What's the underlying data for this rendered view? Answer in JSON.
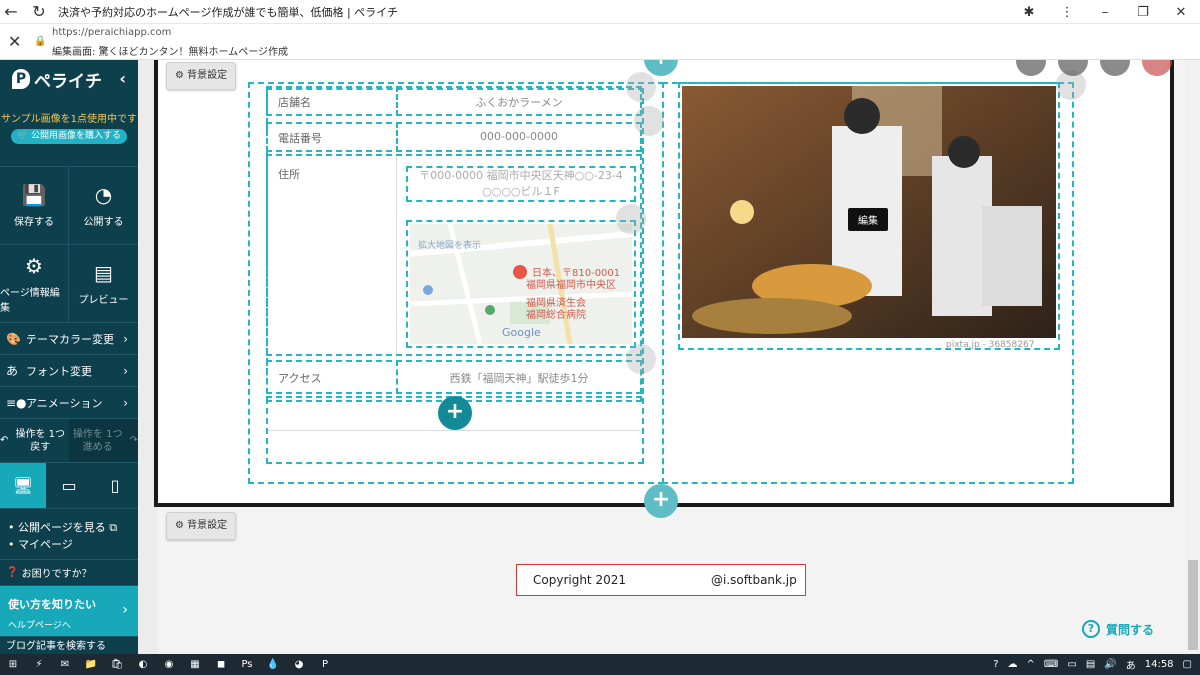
{
  "browser": {
    "tab_title": "決済や予約対応のホームページ作成が誰でも簡単、低価格 | ペライチ",
    "url": "https://peraichiapp.com",
    "site_description": "編集画面: 驚くほどカンタン！無料ホームページ作成"
  },
  "sidebar": {
    "logo": "ペライチ",
    "sample_notice": "サンプル画像を1点使用中です",
    "buy_button": "公開用画像を購入する",
    "actions": [
      {
        "label": "保存する",
        "icon": "save-icon"
      },
      {
        "label": "公開する",
        "icon": "publish-icon"
      },
      {
        "label": "ページ情報編集",
        "icon": "gear-icon"
      },
      {
        "label": "プレビュー",
        "icon": "preview-icon"
      }
    ],
    "menu": [
      {
        "label": "テーマカラー変更",
        "icon": "palette-icon"
      },
      {
        "label": "フォント変更",
        "icon": "font-icon"
      },
      {
        "label": "アニメーション",
        "icon": "animation-icon"
      }
    ],
    "undo": "操作を 1つ戻す",
    "redo": "操作を 1つ進める",
    "links": [
      "公開ページを見る",
      "マイページ"
    ],
    "help": "お困りですか？",
    "howto_title": "使い方を知りたい",
    "howto_sub": "ヘルプページへ",
    "bottom_text": "ブログ記事を検索する"
  },
  "editor": {
    "bg_setting_label": "背景設定",
    "rows": [
      {
        "label": "店舗名",
        "value": "ふくおかラーメン"
      },
      {
        "label": "電話番号",
        "value": "000-000-0000"
      },
      {
        "label": "住所",
        "value": "〒000-0000 福岡市中央区天神○○-23-4 ○○○○ビル１F"
      },
      {
        "label": "アクセス",
        "value": "西鉄「福岡天神」駅徒歩1分"
      }
    ],
    "map_labels": {
      "enlarge": "拡大地図を表示",
      "postal": "日本、〒810-0001",
      "pref": "福岡県福岡市中央区",
      "hospital": "福岡県済生会",
      "hospital2": "福岡総合病院",
      "google": "Google"
    },
    "photo_edit_label": "編集",
    "photo_credit": "pixta.jp - 36858267",
    "copyright_left": "Copyright 2021",
    "copyright_right": "@i.softbank.jp",
    "ask_button": "質問する"
  },
  "taskbar": {
    "time": "14:58",
    "ime": "あ"
  },
  "colors": {
    "sidebar_bg": "#0e3f4d",
    "accent": "#17a8b9",
    "dash": "#25b6c4",
    "copyright_border": "#d9383a"
  }
}
